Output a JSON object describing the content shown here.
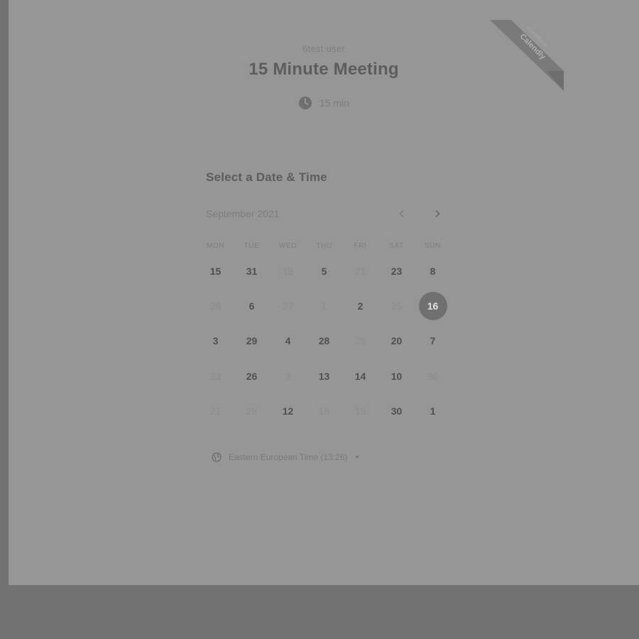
{
  "colors": {
    "page_bg": "#727272",
    "card_bg": "#969696",
    "selected_day_bg": "#707070",
    "available_day_text": "#505050",
    "unavailable_day_text": "#8c8c8c"
  },
  "header": {
    "host_name": "6test user",
    "event_title": "15 Minute Meeting",
    "duration_icon": "clock-icon",
    "duration_label": "15 min"
  },
  "badge": {
    "line1": "POWERED BY",
    "line2": "Calendly"
  },
  "calendar": {
    "section_title": "Select a Date & Time",
    "month_label": "September 2021",
    "prev_icon": "chevron-left-icon",
    "next_icon": "chevron-right-icon",
    "weekdays": [
      "MON",
      "TUE",
      "WED",
      "THU",
      "FRI",
      "SAT",
      "SUN"
    ],
    "days": [
      {
        "label": "15",
        "available": true
      },
      {
        "label": "31",
        "available": true
      },
      {
        "label": "18",
        "available": false
      },
      {
        "label": "5",
        "available": true
      },
      {
        "label": "21",
        "available": false
      },
      {
        "label": "23",
        "available": true
      },
      {
        "label": "8",
        "available": true
      },
      {
        "label": "28",
        "available": false
      },
      {
        "label": "6",
        "available": true
      },
      {
        "label": "27",
        "available": false
      },
      {
        "label": "1",
        "available": false
      },
      {
        "label": "2",
        "available": true
      },
      {
        "label": "25",
        "available": false
      },
      {
        "label": "16",
        "available": true,
        "selected": true
      },
      {
        "label": "3",
        "available": true
      },
      {
        "label": "29",
        "available": true
      },
      {
        "label": "4",
        "available": true
      },
      {
        "label": "28",
        "available": true
      },
      {
        "label": "29",
        "available": false
      },
      {
        "label": "20",
        "available": true
      },
      {
        "label": "7",
        "available": true
      },
      {
        "label": "23",
        "available": false
      },
      {
        "label": "26",
        "available": true
      },
      {
        "label": "3",
        "available": false
      },
      {
        "label": "13",
        "available": true
      },
      {
        "label": "14",
        "available": true
      },
      {
        "label": "10",
        "available": true
      },
      {
        "label": "30",
        "available": false
      },
      {
        "label": "21",
        "available": false
      },
      {
        "label": "28",
        "available": false
      },
      {
        "label": "12",
        "available": true
      },
      {
        "label": "18",
        "available": false
      },
      {
        "label": "19",
        "available": false
      },
      {
        "label": "30",
        "available": true
      },
      {
        "label": "1",
        "available": true
      }
    ]
  },
  "timezone": {
    "icon": "globe-icon",
    "label": "Eastern European Time (13:26)",
    "dropdown_icon": "caret-down-icon"
  }
}
